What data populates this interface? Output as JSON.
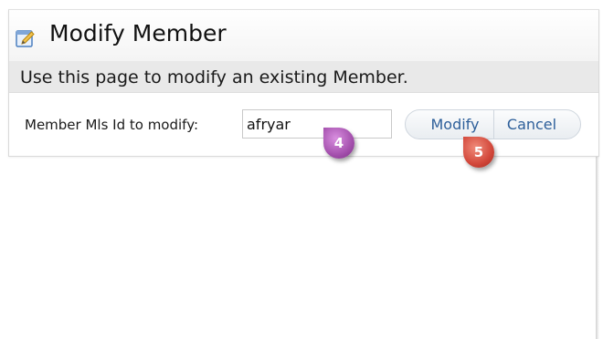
{
  "header": {
    "title": "Modify Member",
    "title_icon": "edit-note-icon"
  },
  "subtitle": "Use this page to modify an existing Member.",
  "form": {
    "label": "Member Mls Id to modify:",
    "input_value": "afryar"
  },
  "buttons": {
    "modify_label": "Modify",
    "cancel_label": "Cancel"
  },
  "callouts": {
    "step_4": "4",
    "step_5": "5"
  },
  "colors": {
    "button_text": "#2d5f9a",
    "callout_4": "#a450ad",
    "callout_5": "#d2473a"
  }
}
